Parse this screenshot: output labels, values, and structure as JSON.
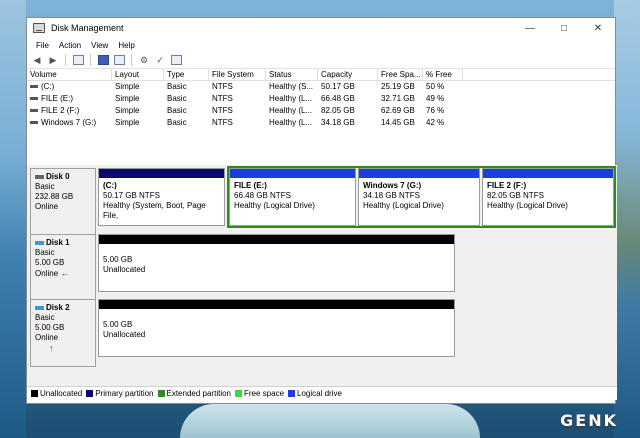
{
  "window": {
    "title": "Disk Management"
  },
  "menu": [
    "File",
    "Action",
    "View",
    "Help"
  ],
  "list": {
    "headers": [
      "Volume",
      "Layout",
      "Type",
      "File System",
      "Status",
      "Capacity",
      "Free Spa...",
      "% Free"
    ],
    "rows": [
      [
        "(C:)",
        "Simple",
        "Basic",
        "NTFS",
        "Healthy (S...",
        "50.17 GB",
        "25.19 GB",
        "50 %"
      ],
      [
        "FILE (E:)",
        "Simple",
        "Basic",
        "NTFS",
        "Healthy (L...",
        "66.48 GB",
        "32.71 GB",
        "49 %"
      ],
      [
        "FILE 2 (F:)",
        "Simple",
        "Basic",
        "NTFS",
        "Healthy (L...",
        "82.05 GB",
        "62.69 GB",
        "76 %"
      ],
      [
        "Windows 7 (G:)",
        "Simple",
        "Basic",
        "NTFS",
        "Healthy (L...",
        "34.18 GB",
        "14.45 GB",
        "42 %"
      ]
    ]
  },
  "disks": [
    {
      "name": "Disk 0",
      "type": "Basic",
      "size": "232.88 GB",
      "status": "Online",
      "partitions": [
        {
          "name": "(C:)",
          "size": "50.17 GB NTFS",
          "status": "Healthy (System, Boot, Page File,"
        },
        {
          "name": "FILE  (E:)",
          "size": "66.48 GB NTFS",
          "status": "Healthy (Logical Drive)"
        },
        {
          "name": "Windows 7  (G:)",
          "size": "34.18 GB NTFS",
          "status": "Healthy (Logical Drive)"
        },
        {
          "name": "FILE 2  (F:)",
          "size": "82.05 GB NTFS",
          "status": "Healthy (Logical Drive)"
        }
      ]
    },
    {
      "name": "Disk 1",
      "type": "Basic",
      "size": "5.00 GB",
      "status": "Online",
      "partitions": [
        {
          "size": "5.00 GB",
          "status": "Unallocated"
        }
      ]
    },
    {
      "name": "Disk 2",
      "type": "Basic",
      "size": "5.00 GB",
      "status": "Online",
      "partitions": [
        {
          "size": "5.00 GB",
          "status": "Unallocated"
        }
      ]
    }
  ],
  "legend": [
    {
      "label": "Unallocated",
      "color": "#000000"
    },
    {
      "label": "Primary partition",
      "color": "#0a0a6e"
    },
    {
      "label": "Extended partition",
      "color": "#2e8b1e"
    },
    {
      "label": "Free space",
      "color": "#33dd33"
    },
    {
      "label": "Logical drive",
      "color": "#1c3fdc"
    }
  ],
  "watermark": "GENK"
}
